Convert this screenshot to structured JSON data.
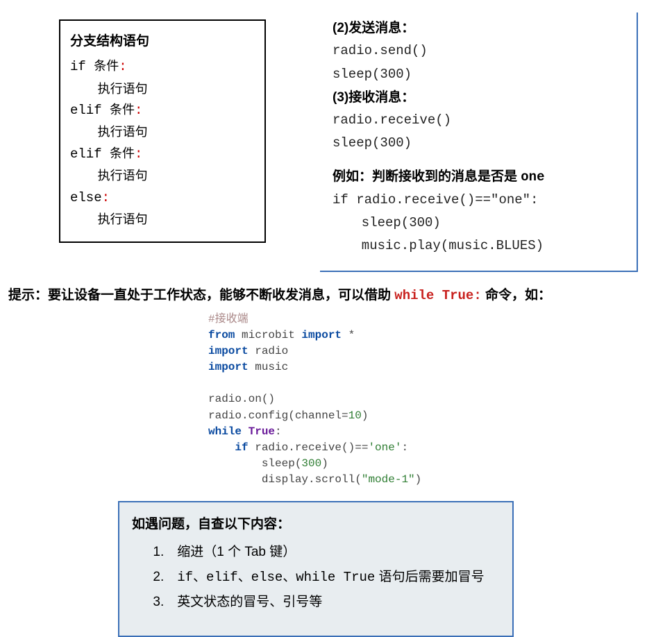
{
  "left_box": {
    "title": "分支结构语句",
    "lines": [
      {
        "code": "if ",
        "cn": "条件",
        "colon": ":"
      },
      {
        "indent": true,
        "cn": "执行语句"
      },
      {
        "code": "elif ",
        "cn": "条件",
        "colon": ":"
      },
      {
        "indent": true,
        "cn": "执行语句"
      },
      {
        "code": "elif ",
        "cn": "条件",
        "colon": ":"
      },
      {
        "indent": true,
        "cn": "执行语句"
      },
      {
        "code": "else",
        "colon": ":"
      },
      {
        "indent": true,
        "cn": "执行语句"
      }
    ]
  },
  "right_box": {
    "sec2_title": "(2)发送消息：",
    "sec2_lines": [
      "radio.send()",
      "sleep(300)"
    ],
    "sec3_title": "(3)接收消息：",
    "sec3_lines": [
      "radio.receive()",
      "sleep(300)"
    ],
    "example_label": "例如：判断接收到的消息是否是 ",
    "example_token": "one",
    "example_lines": [
      "if radio.receive()==\"one\":",
      "    sleep(300)",
      "    music.play(music.BLUES)"
    ]
  },
  "hint": {
    "label": "提示：",
    "text_before": "要让设备一直处于工作状态，能够不断收发消息，可以借助 ",
    "code": "while True:",
    "text_after": " 命令，如："
  },
  "code_block": {
    "comment": "#接收端",
    "l1_a": "from",
    "l1_b": " microbit ",
    "l1_c": "import",
    "l1_d": " *",
    "l2_a": "import",
    "l2_b": " radio",
    "l3_a": "import",
    "l3_b": " music",
    "l4": "radio.on()",
    "l5_a": "radio.config(channel=",
    "l5_b": "10",
    "l5_c": ")",
    "l6_a": "while",
    "l6_b": " ",
    "l6_c": "True",
    "l6_d": ":",
    "l7_a": "    ",
    "l7_b": "if",
    "l7_c": " radio.receive()==",
    "l7_d": "'one'",
    "l7_e": ":",
    "l8_a": "        sleep(",
    "l8_b": "300",
    "l8_c": ")",
    "l9_a": "        display.scroll(",
    "l9_b": "\"mode-1\"",
    "l9_c": ")"
  },
  "check_box": {
    "title": "如遇问题，自查以下内容：",
    "item1": "1.　缩进（1 个 Tab 键）",
    "item2_a": "2.　",
    "item2_b": "if、elif、else、while True",
    "item2_c": " 语句后需要加冒号",
    "item3": "3.　英文状态的冒号、引号等"
  }
}
